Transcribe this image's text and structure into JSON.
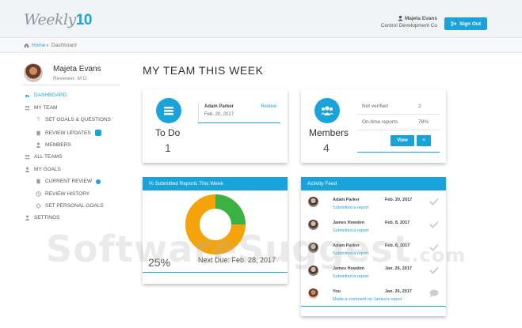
{
  "brand": {
    "logo_text": "Weekly",
    "logo_num": "10"
  },
  "header": {
    "user_name": "Majeta Evans",
    "company": "Control Development Co",
    "signout_label": "Sign Out"
  },
  "breadcrumb": {
    "home": "Home",
    "separator": "»",
    "current": "Dashboard"
  },
  "profile": {
    "name": "Majeta Evans",
    "subtitle": "Reviewer: M D"
  },
  "sidebar": {
    "items": [
      {
        "label": "DASHBOARD"
      },
      {
        "label": "MY TEAM"
      },
      {
        "label": "SET GOALS & QUESTIONS"
      },
      {
        "label": "REVIEW UPDATES"
      },
      {
        "label": "MEMBERS"
      },
      {
        "label": "ALL TEAMS"
      },
      {
        "label": "MY GOALS"
      },
      {
        "label": "CURRENT REVIEW"
      },
      {
        "label": "REVIEW HISTORY"
      },
      {
        "label": "SET PERSONAL GOALS"
      },
      {
        "label": "SETTINGS"
      }
    ]
  },
  "page": {
    "title": "MY TEAM THIS WEEK"
  },
  "todo": {
    "label": "To Do",
    "count": "1",
    "item": {
      "name": "Adam Parker",
      "date": "Feb. 20, 2017",
      "action": "Review"
    }
  },
  "members": {
    "label": "Members",
    "count": "4",
    "stats": [
      {
        "label": "Not verified",
        "value": "2"
      },
      {
        "label": "On-time reports",
        "value": "78%"
      }
    ],
    "view_label": "View",
    "add_label": "+"
  },
  "reports": {
    "title": "% Submitted Reports This Week",
    "percent_text": "25%",
    "next_due": "Next Due: Feb. 28, 2017",
    "submitted_fraction": 0.25,
    "colors": {
      "submitted": "#3cb043",
      "pending": "#f5a30a"
    }
  },
  "activity": {
    "title": "Activity Feed",
    "items": [
      {
        "name": "Adam Parker",
        "date": "Feb. 20, 2017",
        "action": "Submitted a report",
        "icon": "check-icon"
      },
      {
        "name": "James Howden",
        "date": "Feb. 8, 2017",
        "action": "Submitted a report",
        "icon": "check-icon"
      },
      {
        "name": "Adam Parker",
        "date": "Feb. 8, 2017",
        "action": "Submitted a report",
        "icon": "check-icon"
      },
      {
        "name": "James Howden",
        "date": "Jan. 26, 2017",
        "action": "Submitted a report",
        "icon": "check-icon"
      },
      {
        "name": "You",
        "date": "Jan. 26, 2017",
        "action": "Made a comment on James's report",
        "icon": "comment-icon"
      }
    ]
  },
  "watermark": {
    "text": "SoftwareSuggest",
    "suffix": ".com"
  },
  "theme": {
    "accent": "#1aa3d9"
  }
}
